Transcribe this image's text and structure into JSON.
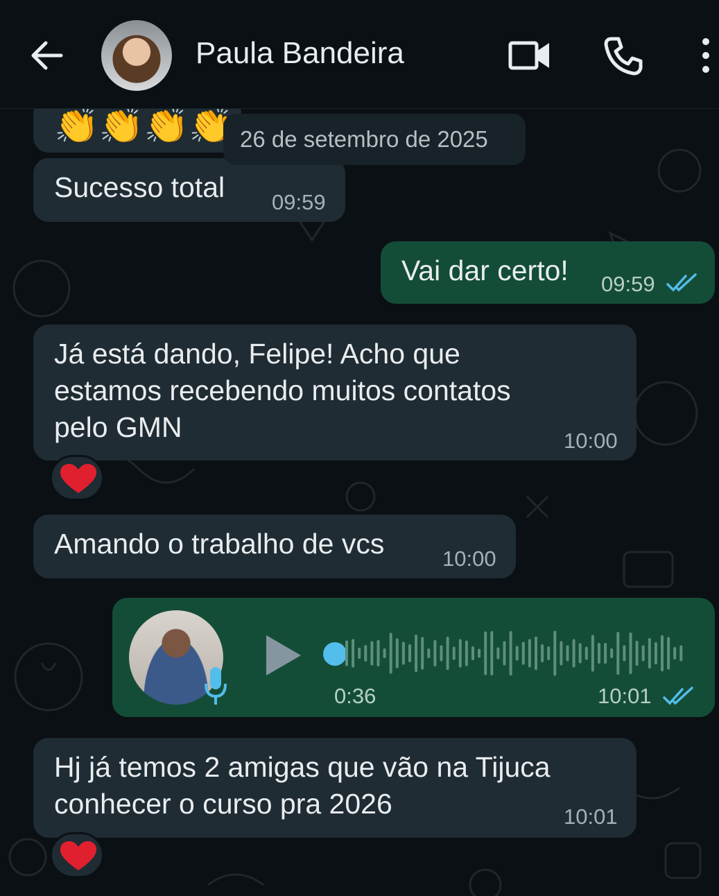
{
  "header": {
    "contact_name": "Paula Bandeira"
  },
  "icons": {
    "back": "arrow-left",
    "video": "video-camera",
    "call": "phone",
    "menu": "vertical-dots"
  },
  "colors": {
    "background": "#0b1014",
    "incoming_bubble": "#1f2c33",
    "outgoing_bubble": "#144d37",
    "read_ticks": "#53bdeb"
  },
  "date_divider": "26 de setembro de 2025",
  "messages": [
    {
      "direction": "incoming",
      "text": "Sucesso total",
      "time": "09:59"
    },
    {
      "direction": "outgoing",
      "text": "Vai dar certo!",
      "time": "09:59",
      "status": "read"
    },
    {
      "direction": "incoming",
      "lines": [
        "Já está dando, Felipe! Acho que",
        "estamos recebendo muitos contatos",
        "pelo GMN"
      ],
      "time": "10:00",
      "reaction": "❤️"
    },
    {
      "direction": "incoming",
      "text": "Amando o trabalho de vcs",
      "time": "10:00"
    },
    {
      "direction": "outgoing",
      "type": "voice",
      "duration": "0:36",
      "time": "10:01",
      "status": "read",
      "progress": 0
    },
    {
      "direction": "incoming",
      "lines": [
        "Hj já temos 2 amigas que vão na Tijuca",
        "conhecer o curso pra 2026"
      ],
      "time": "10:01",
      "reaction": "❤️"
    }
  ]
}
